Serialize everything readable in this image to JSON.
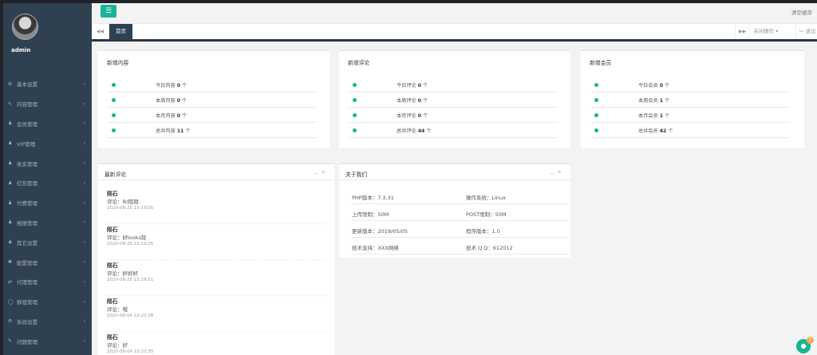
{
  "user": {
    "name": "admin"
  },
  "sidebar": {
    "items": [
      {
        "icon": "gear-icon",
        "glyph": "⚙",
        "label": "基本设置"
      },
      {
        "icon": "edit-icon",
        "glyph": "✎",
        "label": "内容管理"
      },
      {
        "icon": "user-icon",
        "glyph": "♟",
        "label": "会员管理"
      },
      {
        "icon": "user-icon",
        "glyph": "♟",
        "label": "VIP管理"
      },
      {
        "icon": "user-icon",
        "glyph": "♟",
        "label": "收支管理"
      },
      {
        "icon": "user-icon",
        "glyph": "♟",
        "label": "红包管理"
      },
      {
        "icon": "user-icon",
        "glyph": "♟",
        "label": "付费管理"
      },
      {
        "icon": "user-icon",
        "glyph": "♟",
        "label": "相册管理"
      },
      {
        "icon": "user-icon",
        "glyph": "♟",
        "label": "其它设置"
      },
      {
        "icon": "gear-icon",
        "glyph": "✱",
        "label": "配置管理"
      },
      {
        "icon": "exchange-icon",
        "glyph": "⇄",
        "label": "代理管理"
      },
      {
        "icon": "chat-icon",
        "glyph": "◯",
        "label": "群组管理"
      },
      {
        "icon": "cogs-icon",
        "glyph": "⚙",
        "label": "系统设置"
      },
      {
        "icon": "edit-icon",
        "glyph": "✎",
        "label": "问题管理"
      }
    ]
  },
  "topbar": {
    "clear_cache": "清空缓存"
  },
  "tabs": {
    "home": "首页",
    "close_ops": "关闭操作 ▾",
    "exit": "⇨ 退出"
  },
  "stats": [
    {
      "title": "新增内容",
      "rows": [
        {
          "label": "今日内容",
          "value": "0",
          "unit": "个"
        },
        {
          "label": "本周内容",
          "value": "0",
          "unit": "个"
        },
        {
          "label": "本月内容",
          "value": "0",
          "unit": "个"
        },
        {
          "label": "总共内容",
          "value": "11",
          "unit": "个"
        }
      ]
    },
    {
      "title": "新增评论",
      "rows": [
        {
          "label": "今日评论",
          "value": "0",
          "unit": "个"
        },
        {
          "label": "本周评论",
          "value": "0",
          "unit": "个"
        },
        {
          "label": "本月评论",
          "value": "0",
          "unit": "个"
        },
        {
          "label": "总共评论",
          "value": "44",
          "unit": "个"
        }
      ]
    },
    {
      "title": "新增会员",
      "rows": [
        {
          "label": "今日会员",
          "value": "0",
          "unit": "个"
        },
        {
          "label": "本周会员",
          "value": "1",
          "unit": "个"
        },
        {
          "label": "本月会员",
          "value": "1",
          "unit": "个"
        },
        {
          "label": "总共会员",
          "value": "42",
          "unit": "个"
        }
      ]
    }
  ],
  "comments": {
    "title": "最新评论",
    "items": [
      {
        "author": "陨石",
        "body": "评论：lkl阻阻",
        "time": "2020-08-25 15:19:05"
      },
      {
        "author": "陨石",
        "body": "评论：好looks就",
        "time": "2020-08-25 15:19:05"
      },
      {
        "author": "陨石",
        "body": "评论：好好好",
        "time": "2020-08-25 15:18:51"
      },
      {
        "author": "陨石",
        "body": "评论：哦",
        "time": "2020-08-04 10:22:38"
      },
      {
        "author": "陨石",
        "body": "评论：好",
        "time": "2020-08-04 10:22:35"
      }
    ]
  },
  "about": {
    "title": "关于我们",
    "rows": [
      {
        "left": "PHP版本：7.3.31",
        "right": "操作系统：Linux"
      },
      {
        "left": "上传限制：50M",
        "right": "POST限制：50M"
      },
      {
        "left": "更新版本：2019/05/05",
        "right": "程序版本：1.0"
      },
      {
        "left": "技术支持：XXX网络",
        "right": "技术 Q Q：612012"
      }
    ]
  },
  "chat": {
    "count": "1"
  },
  "colors": {
    "accent": "#1ab394",
    "sidebar": "#2f4050"
  }
}
